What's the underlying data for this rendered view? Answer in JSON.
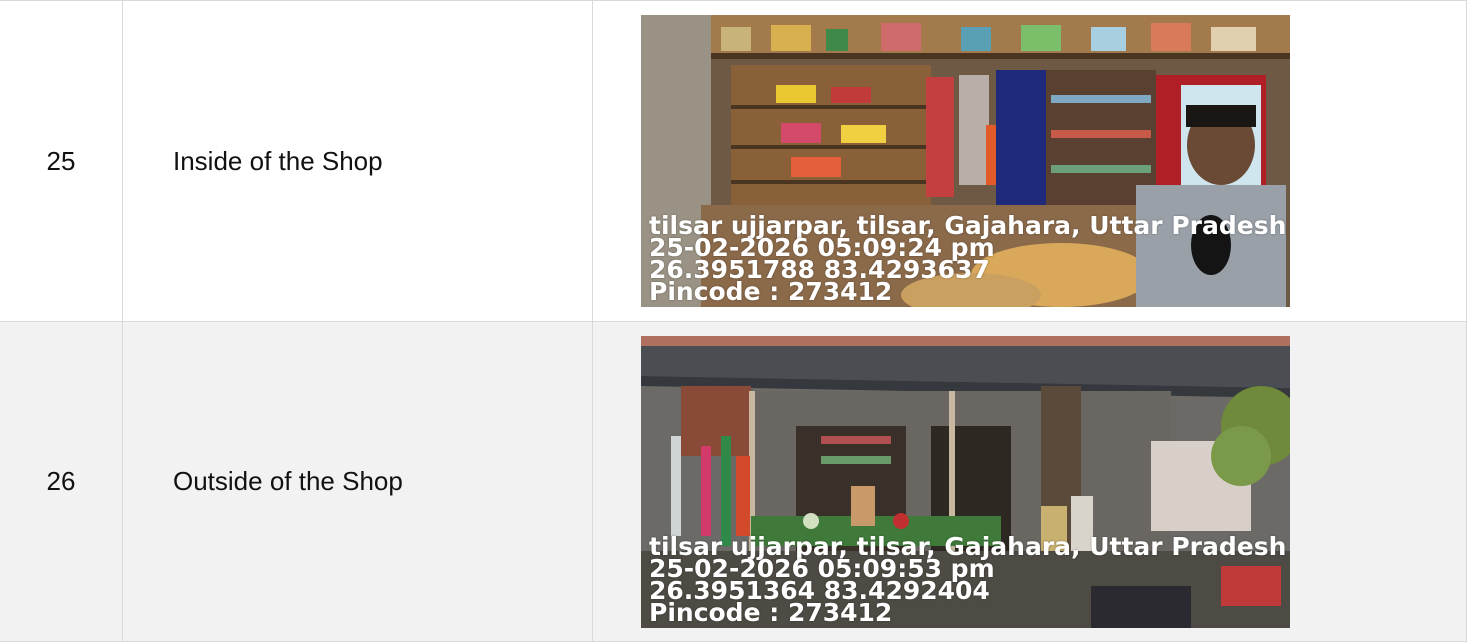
{
  "rows": [
    {
      "number": "25",
      "description": "Inside of the Shop",
      "photo": {
        "address": "tilsar ujjarpar, tilsar, Gajahara, Uttar Pradesh",
        "datetime": "25-02-2026 05:09:24 pm",
        "coords": "26.3951788 83.4293637",
        "pincode": "Pincode : 273412"
      }
    },
    {
      "number": "26",
      "description": "Outside of the Shop",
      "photo": {
        "address": "tilsar ujjarpar, tilsar, Gajahara, Uttar Pradesh",
        "datetime": "25-02-2026 05:09:53 pm",
        "coords": "26.3951364 83.4292404",
        "pincode": "Pincode : 273412"
      }
    }
  ],
  "colors": {
    "border": "#d9d9d9",
    "row_alt_background": "#f2f2f2",
    "stamp_text": "#ffffff"
  }
}
